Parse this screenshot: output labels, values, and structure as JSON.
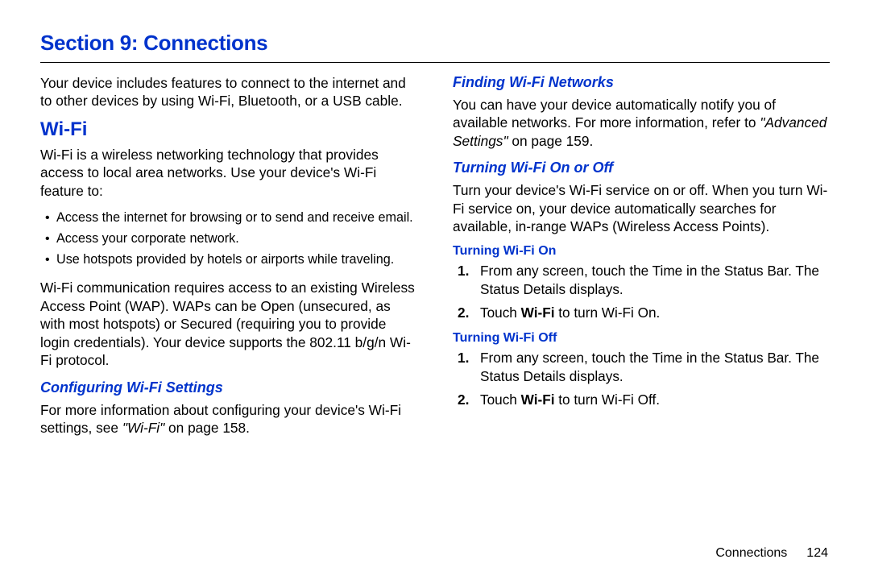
{
  "section_title": "Section 9: Connections",
  "left": {
    "intro": "Your device includes features to connect to the internet and to other devices by using Wi-Fi, Bluetooth, or a USB cable.",
    "wifi_heading": "Wi-Fi",
    "wifi_desc": "Wi-Fi is a wireless networking technology that provides access to local area networks. Use your device's Wi-Fi feature to:",
    "bullets": [
      "Access the internet for browsing or to send and receive email.",
      "Access your corporate network.",
      "Use hotspots provided by hotels or airports while traveling."
    ],
    "wap_para": "Wi-Fi communication requires access to an existing Wireless Access Point (WAP). WAPs can be Open (unsecured, as with most hotspots) or Secured (requiring you to provide login credentials). Your device supports the 802.11 b/g/n Wi-Fi protocol.",
    "config_heading": "Configuring Wi-Fi Settings",
    "config_para_pre": "For more information about configuring your device's Wi-Fi settings, see ",
    "config_ref": "\"Wi-Fi\"",
    "config_para_post": " on page 158."
  },
  "right": {
    "finding_heading": "Finding Wi-Fi Networks",
    "finding_para_pre": "You can have your device automatically notify you of available networks. For more information, refer to ",
    "finding_ref": "\"Advanced Settings\"",
    "finding_para_post": "  on page 159.",
    "turning_heading": "Turning Wi-Fi On or Off",
    "turning_para": "Turn your device's Wi-Fi service on or off. When you turn Wi-Fi service on, your device automatically searches for available, in-range WAPs (Wireless Access Points).",
    "on_heading": "Turning Wi-Fi On",
    "on_steps": {
      "s1a": "From any screen, touch the Time in the Status Bar. The Status Details displays.",
      "s2_pre": "Touch ",
      "s2_bold": "Wi-Fi",
      "s2_post": " to turn Wi-Fi On."
    },
    "off_heading": "Turning Wi-Fi Off",
    "off_steps": {
      "s1a": "From any screen, touch the Time in the Status Bar. The Status Details displays.",
      "s2_pre": "Touch ",
      "s2_bold": "Wi-Fi",
      "s2_post": " to turn Wi-Fi Off."
    }
  },
  "footer": {
    "section": "Connections",
    "page": "124"
  }
}
